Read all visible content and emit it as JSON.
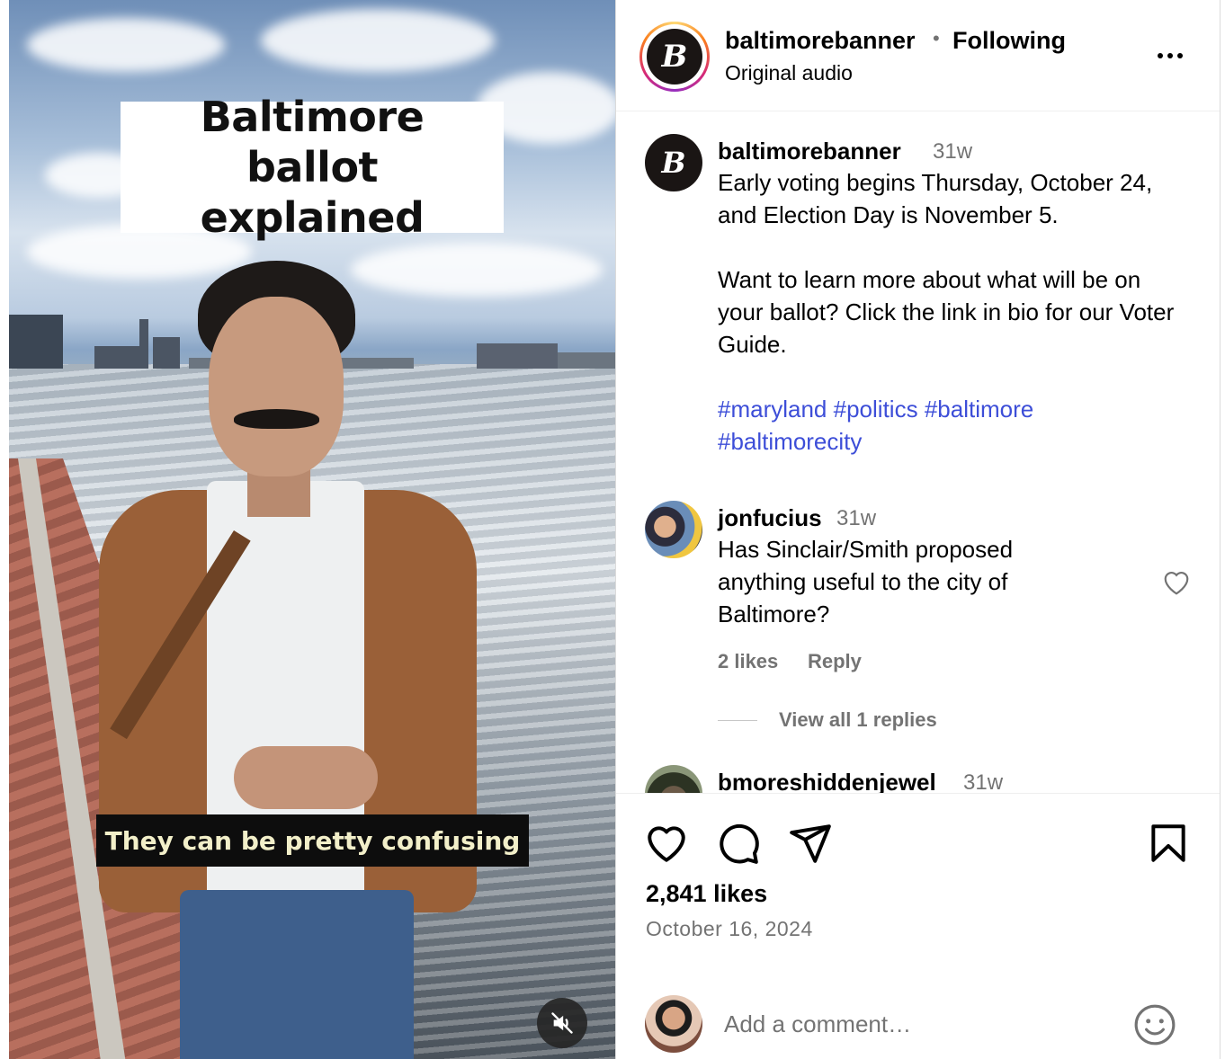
{
  "video": {
    "title_overlay": "Baltimore ballot explained",
    "subtitle": "They can be pretty confusing",
    "mute_icon": "muted-speaker-icon"
  },
  "header": {
    "username": "baltimorebanner",
    "separator": "•",
    "follow_status": "Following",
    "audio": "Original audio",
    "logo_letter": "B",
    "more_icon": "more-options-icon"
  },
  "caption": {
    "username": "baltimorebanner",
    "time": "31w",
    "paragraphs": [
      "Early voting begins Thursday, October 24, and Election Day is November 5.",
      "Want to learn more about what will be on your ballot? Click the link in bio for our Voter Guide."
    ],
    "hashtags": [
      "#maryland",
      "#politics",
      "#baltimore",
      "#baltimorecity"
    ]
  },
  "comments": [
    {
      "username": "jonfucius",
      "time": "31w",
      "text": "Has Sinclair/Smith proposed anything useful to the city of Baltimore?",
      "likes": "2 likes",
      "reply": "Reply",
      "view_replies": "View all 1 replies"
    },
    {
      "username": "bmoreshiddenjewel",
      "time": "31w"
    }
  ],
  "actions": {
    "icons": [
      "heart-icon",
      "comment-icon",
      "share-icon",
      "bookmark-icon"
    ],
    "likes": "2,841 likes",
    "date": "October 16, 2024"
  },
  "add_comment": {
    "placeholder": "Add a comment…",
    "emoji_icon": "emoji-icon"
  },
  "colors": {
    "hashtag": "#3d4ed8",
    "secondary_text": "#737373",
    "border": "#dbdbdb"
  }
}
